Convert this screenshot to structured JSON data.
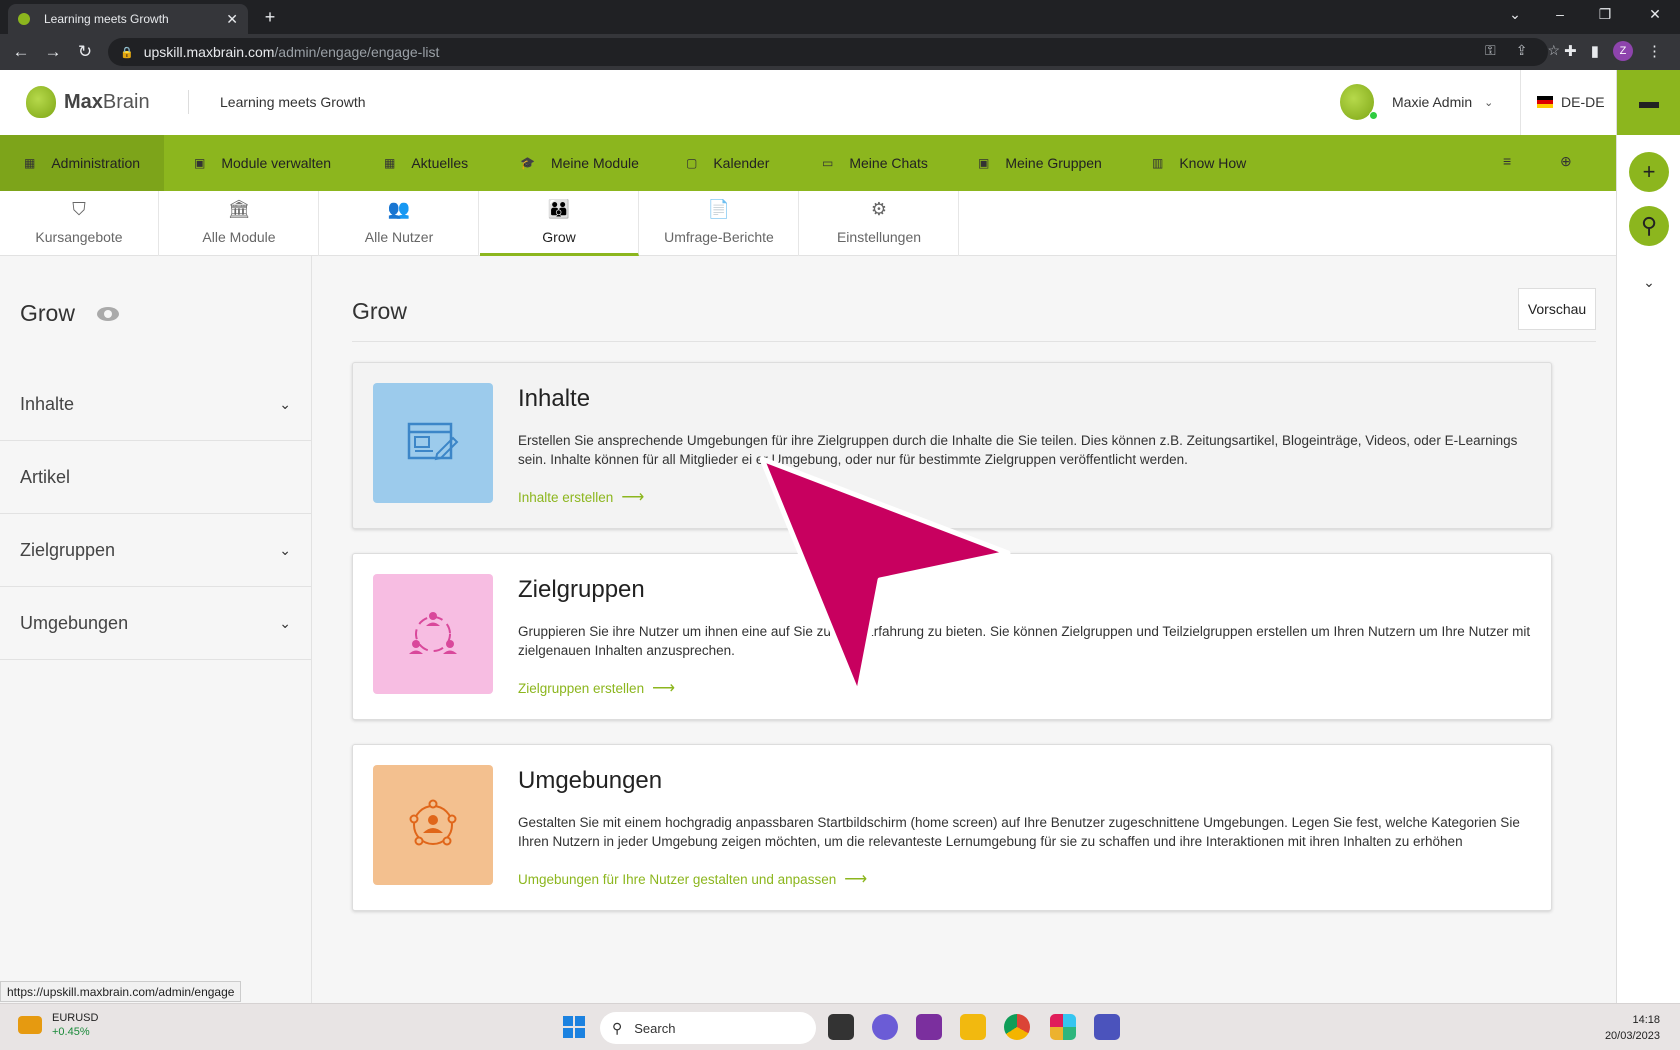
{
  "browser": {
    "tab_title": "Learning meets Growth",
    "tab_close": "✕",
    "new_tab": "+",
    "url_host": "upskill.maxbrain.com",
    "url_path": "/admin/engage/engage-list",
    "profile_initial": "Z"
  },
  "header": {
    "brand_bold": "Max",
    "brand_light": "Brain",
    "tagline": "Learning meets Growth",
    "user_name": "Maxie Admin",
    "language": "DE-DE"
  },
  "mainnav": {
    "items": [
      {
        "label": "Administration",
        "icon": "dashboard-icon",
        "glyph": "▦"
      },
      {
        "label": "Module verwalten",
        "icon": "folder-icon",
        "glyph": "▣"
      },
      {
        "label": "Aktuelles",
        "icon": "news-icon",
        "glyph": "▦"
      },
      {
        "label": "Meine Module",
        "icon": "graduation-cap-icon",
        "glyph": "🎓"
      },
      {
        "label": "Kalender",
        "icon": "calendar-icon",
        "glyph": "▢"
      },
      {
        "label": "Meine Chats",
        "icon": "chat-icon",
        "glyph": "▭"
      },
      {
        "label": "Meine Gruppen",
        "icon": "groups-icon",
        "glyph": "▣"
      },
      {
        "label": "Know How",
        "icon": "book-icon",
        "glyph": "▥"
      }
    ]
  },
  "subtabs": [
    {
      "label": "Kursangebote",
      "icon": "course-offer-icon",
      "glyph": "⛉"
    },
    {
      "label": "Alle Module",
      "icon": "institution-icon",
      "glyph": "🏛"
    },
    {
      "label": "Alle Nutzer",
      "icon": "users-icon",
      "glyph": "👥"
    },
    {
      "label": "Grow",
      "icon": "group-icon",
      "glyph": "👪"
    },
    {
      "label": "Umfrage-Berichte",
      "icon": "report-icon",
      "glyph": "📄"
    },
    {
      "label": "Einstellungen",
      "icon": "settings-gears-icon",
      "glyph": "⚙"
    }
  ],
  "sidebar": {
    "title": "Grow",
    "items": [
      {
        "label": "Inhalte",
        "chevron": "⌄"
      },
      {
        "label": "Artikel",
        "chevron": ""
      },
      {
        "label": "Zielgruppen",
        "chevron": "⌄"
      },
      {
        "label": "Umgebungen",
        "chevron": "⌄"
      }
    ]
  },
  "main": {
    "title": "Grow",
    "preview_button": "Vorschau",
    "cards": [
      {
        "title": "Inhalte",
        "description": "Erstellen Sie ansprechende Umgebungen für ihre Zielgruppen durch die Inhalte die Sie teilen. Dies können z.B. Zeitungsartikel, Blogeinträge, Videos, oder E-Learnings sein. Inhalte können für all Mitglieder ei  er Umgebung, oder nur für bestimmte Zielgruppen veröffentlicht werden.",
        "link": "Inhalte erstellen",
        "color": "#9ccbec",
        "icon": "browser-edit-icon"
      },
      {
        "title": "Zielgruppen",
        "description": "Gruppieren Sie ihre Nutzer um ihnen eine auf Sie zu           tene Erfahrung zu bieten. Sie können Zielgruppen und Teilzielgruppen erstellen um Ihren Nutzern um Ihre Nutzer mit zielgenauen Inhalten anzusprechen.",
        "link": "Zielgruppen erstellen",
        "color": "#f7bde2",
        "icon": "target-group-icon"
      },
      {
        "title": "Umgebungen",
        "description": "Gestalten Sie mit einem hochgradig anpassbaren Startbildschirm (home screen) auf Ihre Benutzer zugeschnittene Umgebungen. Legen Sie fest, welche Kategorien Sie Ihren Nutzern in jeder Umgebung zeigen möchten, um die relevanteste Lernumgebung für sie zu schaffen und ihre Interaktionen mit ihren Inhalten zu erhöhen",
        "link": "Umgebungen für Ihre Nutzer gestalten und anpassen",
        "color": "#f3c08f",
        "icon": "environment-icon"
      }
    ],
    "link_arrow": "⟶"
  },
  "status_url": "https://upskill.maxbrain.com/admin/engage",
  "taskbar": {
    "ticker_name": "EURUSD",
    "ticker_value": "+0.45%",
    "search_placeholder": "Search",
    "time": "14:18",
    "date": "20/03/2023"
  },
  "colors": {
    "brand_green": "#8cb61e",
    "cursor_magenta": "#c8005f"
  }
}
